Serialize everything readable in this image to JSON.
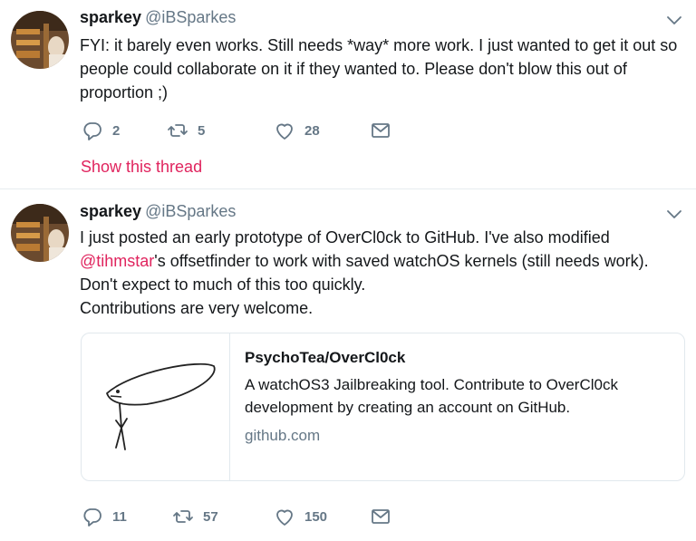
{
  "tweets": [
    {
      "name": "sparkey",
      "handle": "@iBSparkes",
      "text": [
        "FYI: it barely even works. Still needs *way* more work. I just wanted to get it out so people could collaborate on it if they wanted to. Please don't blow this out of proportion ;)"
      ],
      "replies": "2",
      "retweets": "5",
      "likes": "28",
      "show_thread": "Show this thread"
    },
    {
      "name": "sparkey",
      "handle": "@iBSparkes",
      "text_line1": "I just posted an early prototype of OverCl0ck to GitHub. I've also modified",
      "mention": "@tihmstar",
      "text_after_mention": "'s offsetfinder to work with saved watchOS kernels (still needs work).",
      "text_line3": "Don't expect to much of this too quickly.",
      "text_line4": "Contributions are very welcome.",
      "card": {
        "title": "PsychoTea/OverCl0ck",
        "description": "A watchOS3 Jailbreaking tool. Contribute to OverCl0ck development by creating an account on GitHub.",
        "domain": "github.com"
      },
      "replies": "11",
      "retweets": "57",
      "likes": "150"
    }
  ],
  "icons": {
    "reply": "reply-icon",
    "retweet": "retweet-icon",
    "like": "heart-icon",
    "dm": "envelope-icon",
    "caret": "chevron-down-icon"
  },
  "colors": {
    "accent": "#e0245e",
    "secondary_text": "#657786",
    "icon": "#657786",
    "border": "#e1e8ed"
  }
}
